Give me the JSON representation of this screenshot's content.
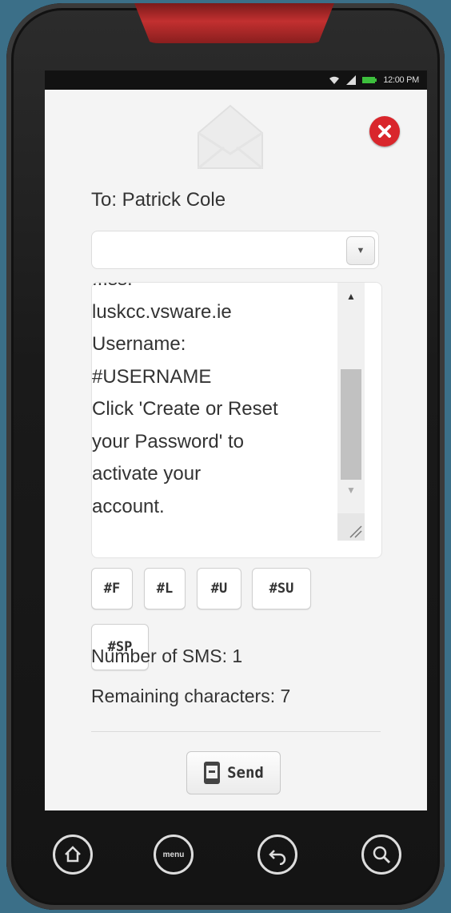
{
  "status_bar": {
    "time": "12:00 PM"
  },
  "compose": {
    "to_label": "To: Patrick Cole",
    "recipient_select_value": "",
    "message_lines": [
      "luskcc.vsware.ie",
      "Username:",
      "#USERNAME",
      "Click 'Create or Reset",
      "your Password' to",
      "activate your",
      "account."
    ],
    "message_partial_top": "...ss:",
    "tags": [
      "#F",
      "#L",
      "#U",
      "#SU",
      "#SP"
    ],
    "sms_count_label": "Number of SMS: 1",
    "remaining_label": "Remaining characters: 7",
    "send_label": "Send"
  },
  "nav": {
    "menu_label": "menu",
    "buttons": [
      "home-icon",
      "menu-icon",
      "back-icon",
      "search-icon"
    ]
  },
  "colors": {
    "close_red": "#d9262c",
    "speaker_red": "#c23030",
    "background": "#3b6f88"
  }
}
